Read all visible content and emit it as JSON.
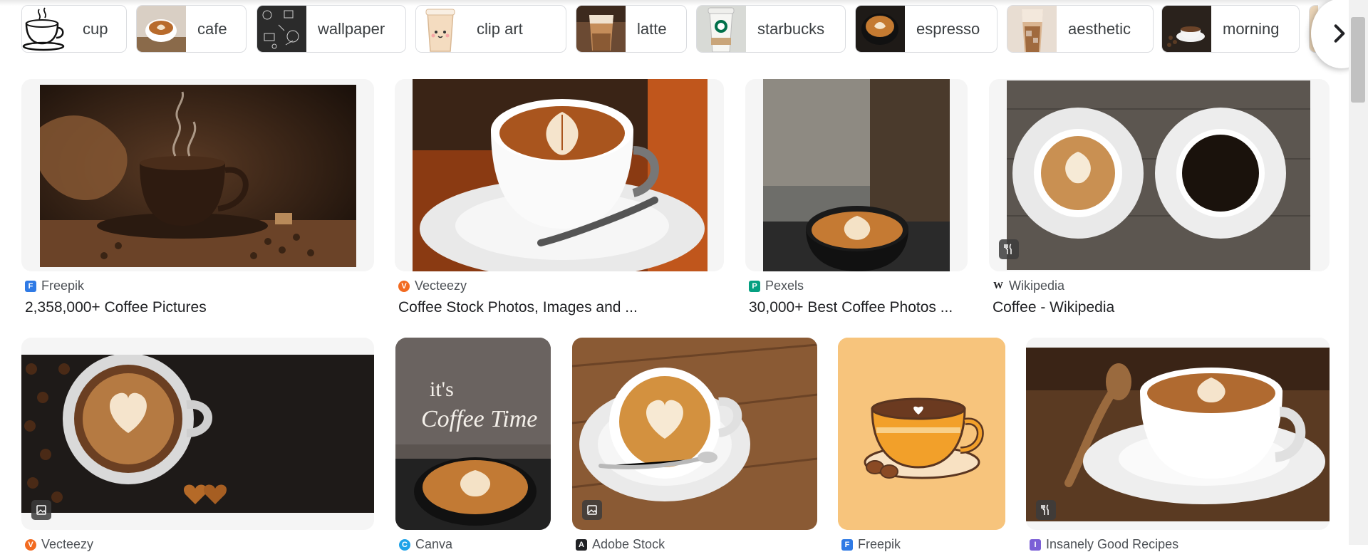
{
  "chips": [
    {
      "label": "cup",
      "icon": "coffee-cup-sketch"
    },
    {
      "label": "cafe",
      "icon": "cafe-latte-thumb"
    },
    {
      "label": "wallpaper",
      "icon": "chalkboard-thumb"
    },
    {
      "label": "clip art",
      "icon": "cartoon-cup-thumb"
    },
    {
      "label": "latte",
      "icon": "latte-glass-thumb"
    },
    {
      "label": "starbucks",
      "icon": "starbucks-cup-thumb"
    },
    {
      "label": "espresso",
      "icon": "espresso-thumb"
    },
    {
      "label": "aesthetic",
      "icon": "iced-coffee-thumb"
    },
    {
      "label": "morning",
      "icon": "morning-coffee-thumb"
    }
  ],
  "chips_next_icon": "chevron-right-icon",
  "results": [
    {
      "source": "Freepik",
      "title": "2,358,000+ Coffee Pictures",
      "favicon_color": "#2f7ae5",
      "favicon_char": "F",
      "badge": ""
    },
    {
      "source": "Vecteezy",
      "title": "Coffee Stock Photos, Images and ...",
      "favicon_color": "#f26b21",
      "favicon_char": "V",
      "badge": ""
    },
    {
      "source": "Pexels",
      "title": "30,000+ Best Coffee Photos ...",
      "favicon_color": "#05a081",
      "favicon_char": "P",
      "badge": ""
    },
    {
      "source": "Wikipedia",
      "title": "Coffee - Wikipedia",
      "favicon_color": "#ffffff",
      "favicon_char": "W",
      "badge": "recipe-icon"
    },
    {
      "source": "Vecteezy",
      "title": "",
      "favicon_color": "#f26b21",
      "favicon_char": "V",
      "badge": "image-icon"
    },
    {
      "source": "Canva",
      "title": "",
      "favicon_color": "#1fa3e8",
      "favicon_char": "C",
      "badge": ""
    },
    {
      "source": "Adobe Stock",
      "title": "",
      "favicon_color": "#202124",
      "favicon_char": "A",
      "badge": "image-icon"
    },
    {
      "source": "Freepik",
      "title": "",
      "favicon_color": "#2f7ae5",
      "favicon_char": "F",
      "badge": ""
    },
    {
      "source": "Insanely Good Recipes",
      "title": "",
      "favicon_color": "#7b5fd6",
      "favicon_char": "I",
      "badge": "recipe-icon"
    }
  ],
  "overlay_texts": {
    "its": "it's",
    "coffee_time": "Coffee Time"
  }
}
